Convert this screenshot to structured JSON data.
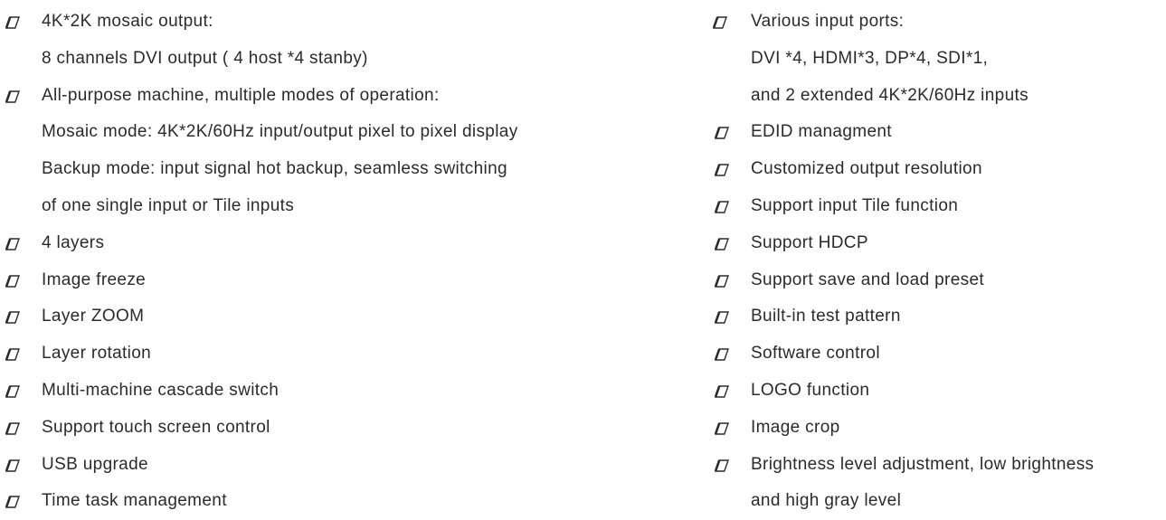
{
  "left_column": [
    {
      "bullet": true,
      "text": "4K*2K mosaic output:"
    },
    {
      "bullet": false,
      "text": "8 channels DVI output ( 4 host *4 stanby)"
    },
    {
      "bullet": true,
      "text": "All-purpose machine, multiple modes of operation:"
    },
    {
      "bullet": false,
      "text": "Mosaic mode: 4K*2K/60Hz input/output pixel to pixel display"
    },
    {
      "bullet": false,
      "text": "Backup mode: input signal hot backup, seamless switching"
    },
    {
      "bullet": false,
      "text": "of one single input or Tile inputs"
    },
    {
      "bullet": true,
      "text": "4 layers"
    },
    {
      "bullet": true,
      "text": "Image freeze"
    },
    {
      "bullet": true,
      "text": " Layer ZOOM"
    },
    {
      "bullet": true,
      "text": "Layer rotation"
    },
    {
      "bullet": true,
      "text": "Multi-machine cascade switch"
    },
    {
      "bullet": true,
      "text": "Support touch screen control"
    },
    {
      "bullet": true,
      "text": "USB upgrade"
    },
    {
      "bullet": true,
      "text": "Time task management"
    }
  ],
  "right_column": [
    {
      "bullet": true,
      "text": "Various input ports:"
    },
    {
      "bullet": false,
      "text": "DVI *4, HDMI*3, DP*4, SDI*1,"
    },
    {
      "bullet": false,
      "text": "and 2 extended 4K*2K/60Hz inputs"
    },
    {
      "bullet": true,
      "text": "EDID managment"
    },
    {
      "bullet": true,
      "text": "Customized output resolution"
    },
    {
      "bullet": true,
      "text": "Support input Tile function"
    },
    {
      "bullet": true,
      "text": "Support HDCP"
    },
    {
      "bullet": true,
      "text": "Support save and load preset"
    },
    {
      "bullet": true,
      "text": "Built-in test pattern"
    },
    {
      "bullet": true,
      "text": "Software control"
    },
    {
      "bullet": true,
      "text": " LOGO function"
    },
    {
      "bullet": true,
      "text": "Image crop"
    },
    {
      "bullet": true,
      "text": "Brightness level adjustment, low brightness"
    },
    {
      "bullet": false,
      "text": "and high gray level"
    }
  ],
  "colors": {
    "text": "#2b2b2b",
    "bullet": "#2b2b2b",
    "background": "#ffffff"
  },
  "icons": {
    "bullet": "parallelogram-bullet-icon"
  }
}
